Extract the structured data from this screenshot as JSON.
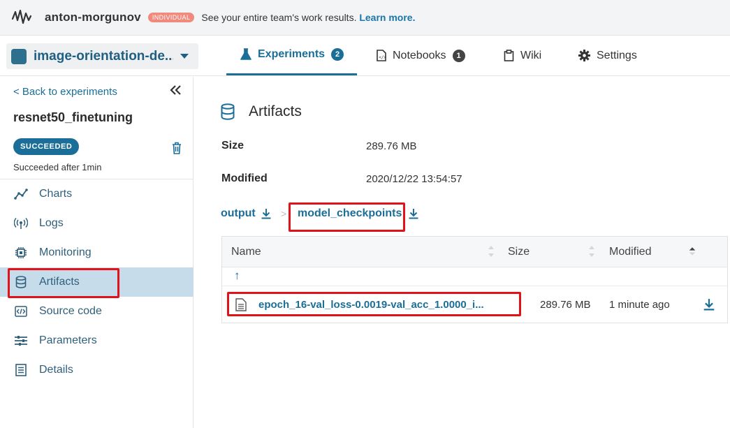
{
  "topbar": {
    "workspace": "anton-morgunov",
    "plan_badge": "INDIVIDUAL",
    "promo_text": "See your entire team's work results.",
    "promo_link": "Learn more."
  },
  "project": {
    "name": "image-orientation-de..."
  },
  "tabs": [
    {
      "label": "Experiments",
      "count": "2",
      "icon": "flask-icon",
      "active": true
    },
    {
      "label": "Notebooks",
      "count": "1",
      "icon": "notebook-icon"
    },
    {
      "label": "Wiki",
      "icon": "clipboard-icon"
    },
    {
      "label": "Settings",
      "icon": "gear-icon"
    }
  ],
  "sidebar": {
    "back_label": "< Back to experiments",
    "experiment_name": "resnet50_finetuning",
    "status_badge": "SUCCEEDED",
    "status_text": "Succeeded after 1min",
    "items": [
      {
        "label": "Charts",
        "icon": "chart-line-icon"
      },
      {
        "label": "Logs",
        "icon": "broadcast-icon"
      },
      {
        "label": "Monitoring",
        "icon": "chip-icon"
      },
      {
        "label": "Artifacts",
        "icon": "database-icon",
        "active": true
      },
      {
        "label": "Source code",
        "icon": "code-file-icon"
      },
      {
        "label": "Parameters",
        "icon": "sliders-icon"
      },
      {
        "label": "Details",
        "icon": "list-icon"
      }
    ]
  },
  "main": {
    "heading": "Artifacts",
    "size_label": "Size",
    "size_value": "289.76 MB",
    "modified_label": "Modified",
    "modified_value": "2020/12/22 13:54:57",
    "breadcrumb": [
      "output",
      "model_checkpoints"
    ],
    "breadcrumb_separator": ">",
    "table": {
      "columns": [
        "Name",
        "Size",
        "Modified"
      ],
      "up_arrow": "↑",
      "rows": [
        {
          "name": "epoch_16-val_loss-0.0019-val_acc_1.0000_i...",
          "size": "289.76 MB",
          "modified": "1 minute ago"
        }
      ]
    }
  },
  "colors": {
    "accent": "#1a6e98",
    "highlight_box": "#e0131b",
    "active_nav_bg": "#c7dceb"
  }
}
